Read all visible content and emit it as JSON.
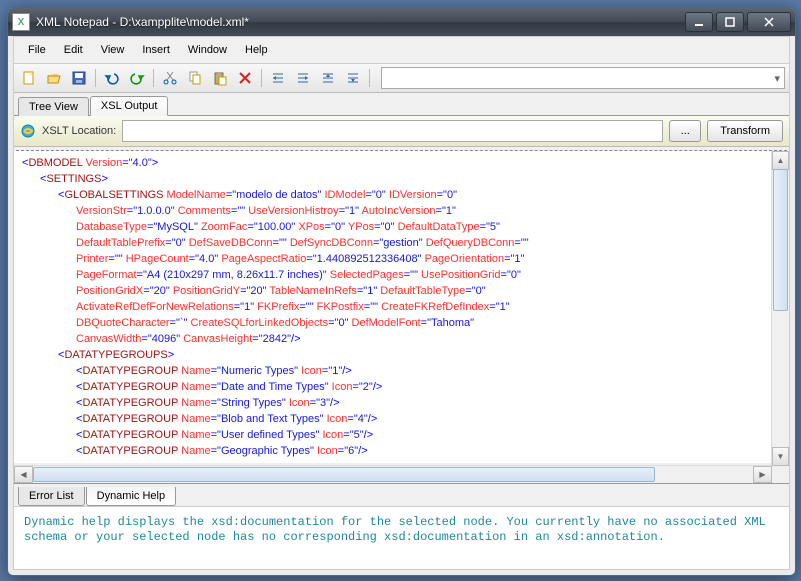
{
  "window": {
    "title": "XML Notepad - D:\\xampplite\\model.xml*",
    "app_icon_letter": "X"
  },
  "menu": {
    "file": "File",
    "edit": "Edit",
    "view": "View",
    "insert": "Insert",
    "window": "Window",
    "help": "Help"
  },
  "tabs": {
    "tree": "Tree View",
    "xsl": "XSL Output"
  },
  "xslt": {
    "label": "XSLT Location:",
    "value": "",
    "browse": "...",
    "transform": "Transform"
  },
  "xml": {
    "root_open": {
      "tag": "DBMODEL",
      "attrs": [
        [
          "Version",
          "4.0"
        ]
      ]
    },
    "settings_open": {
      "tag": "SETTINGS"
    },
    "global": {
      "tag": "GLOBALSETTINGS",
      "lines": [
        [
          [
            "ModelName",
            "modelo de datos"
          ],
          [
            "IDModel",
            "0"
          ],
          [
            "IDVersion",
            "0"
          ]
        ],
        [
          [
            "VersionStr",
            "1.0.0.0"
          ],
          [
            "Comments",
            ""
          ],
          [
            "UseVersionHistroy",
            "1"
          ],
          [
            "AutoIncVersion",
            "1"
          ]
        ],
        [
          [
            "DatabaseType",
            "MySQL"
          ],
          [
            "ZoomFac",
            "100.00"
          ],
          [
            "XPos",
            "0"
          ],
          [
            "YPos",
            "0"
          ],
          [
            "DefaultDataType",
            "5"
          ]
        ],
        [
          [
            "DefaultTablePrefix",
            "0"
          ],
          [
            "DefSaveDBConn",
            ""
          ],
          [
            "DefSyncDBConn",
            "gestion"
          ],
          [
            "DefQueryDBConn",
            ""
          ]
        ],
        [
          [
            "Printer",
            ""
          ],
          [
            "HPageCount",
            "4.0"
          ],
          [
            "PageAspectRatio",
            "1.440892512336408"
          ],
          [
            "PageOrientation",
            "1"
          ]
        ],
        [
          [
            "PageFormat",
            "A4 (210x297 mm, 8.26x11.7 inches)"
          ],
          [
            "SelectedPages",
            ""
          ],
          [
            "UsePositionGrid",
            "0"
          ]
        ],
        [
          [
            "PositionGridX",
            "20"
          ],
          [
            "PositionGridY",
            "20"
          ],
          [
            "TableNameInRefs",
            "1"
          ],
          [
            "DefaultTableType",
            "0"
          ]
        ],
        [
          [
            "ActivateRefDefForNewRelations",
            "1"
          ],
          [
            "FKPrefix",
            ""
          ],
          [
            "FKPostfix",
            ""
          ],
          [
            "CreateFKRefDefIndex",
            "1"
          ]
        ],
        [
          [
            "DBQuoteCharacter",
            "`"
          ],
          [
            "CreateSQLforLinkedObjects",
            "0"
          ],
          [
            "DefModelFont",
            "Tahoma"
          ]
        ],
        [
          [
            "CanvasWidth",
            "4096"
          ],
          [
            "CanvasHeight",
            "2842"
          ]
        ]
      ]
    },
    "dtgroups_open": {
      "tag": "DATATYPEGROUPS"
    },
    "dtgroup_items": [
      [
        [
          "Name",
          "Numeric Types"
        ],
        [
          "Icon",
          "1"
        ]
      ],
      [
        [
          "Name",
          "Date and Time Types"
        ],
        [
          "Icon",
          "2"
        ]
      ],
      [
        [
          "Name",
          "String Types"
        ],
        [
          "Icon",
          "3"
        ]
      ],
      [
        [
          "Name",
          "Blob and Text Types"
        ],
        [
          "Icon",
          "4"
        ]
      ],
      [
        [
          "Name",
          "User defined Types"
        ],
        [
          "Icon",
          "5"
        ]
      ],
      [
        [
          "Name",
          "Geographic Types"
        ],
        [
          "Icon",
          "6"
        ]
      ]
    ],
    "dt_tag": "DATATYPEGROUP"
  },
  "bottom_tabs": {
    "error": "Error List",
    "help": "Dynamic Help"
  },
  "help_text": "Dynamic help displays the xsd:documentation for the selected node. You currently have no associated XML schema or your selected node has no corresponding xsd:documentation in an xsd:annotation."
}
